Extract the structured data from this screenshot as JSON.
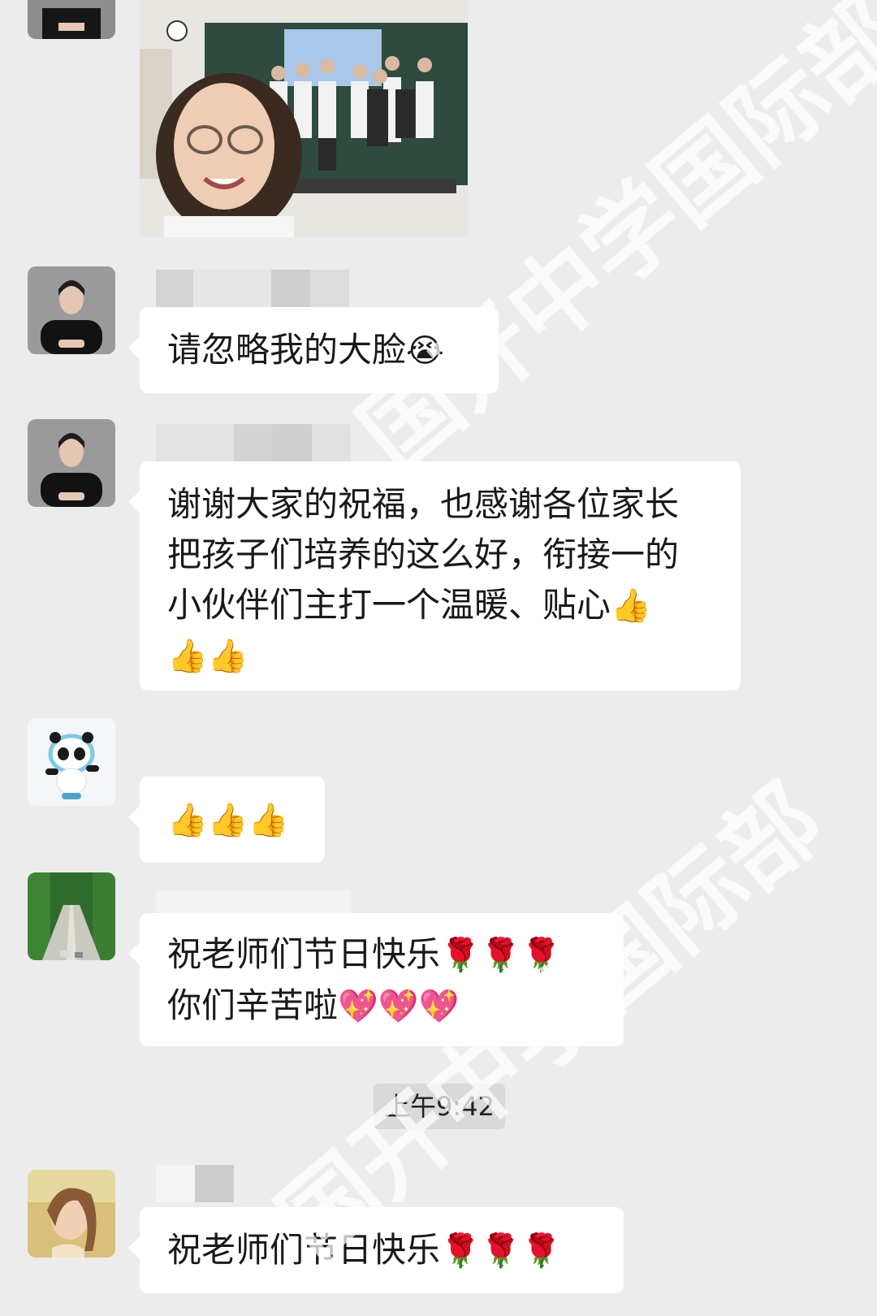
{
  "messages": [
    {
      "type": "image",
      "image_description": ""
    },
    {
      "type": "text",
      "text": "请忽略我的大脸",
      "emoji": "😭"
    },
    {
      "type": "text",
      "lines": [
        "谢谢大家的祝福，也感谢各位家长",
        "把孩子们培养的这么好，衔接一的",
        "小伙伴们主打一个温暖、贴心"
      ],
      "emoji_inline": "👍",
      "emoji_line": "👍👍"
    },
    {
      "type": "text",
      "emoji": "👍👍👍"
    },
    {
      "type": "text",
      "lines": [
        "祝老师们节日快乐",
        "你们辛苦啦"
      ],
      "emoji_line1": "🌹🌹🌹",
      "emoji_line2": "💖💖💖"
    },
    {
      "type": "text",
      "text": "祝老师们节日快乐",
      "emoji": "🌹🌹🌹"
    }
  ],
  "timestamp": "上午9:42",
  "watermark": "国开中学国际部",
  "colors": {
    "background": "#ececec",
    "bubble": "#ffffff",
    "timestamp_bg": "#d9d9d9"
  }
}
